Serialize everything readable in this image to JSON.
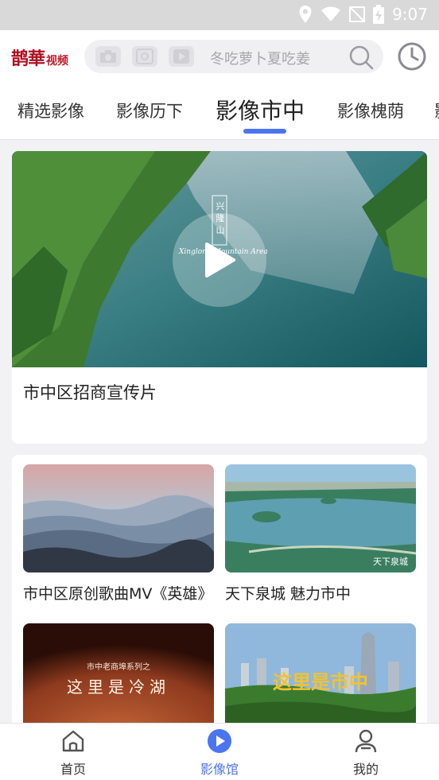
{
  "status_bar": {
    "time": "9:07"
  },
  "header": {
    "logo_main": "鹊華",
    "logo_sub": "视频",
    "search_placeholder": "冬吃萝卜夏吃姜"
  },
  "tabs": [
    {
      "label": "精选影像"
    },
    {
      "label": "影像历下"
    },
    {
      "label": "影像市中",
      "active": true
    },
    {
      "label": "影像槐荫"
    },
    {
      "label": "影"
    }
  ],
  "featured": {
    "title": "市中区招商宣传片",
    "overlay_text": "兴隆山",
    "overlay_sub": "Xinglong Mountain Area"
  },
  "videos": [
    {
      "title": "市中区原创歌曲MV《英雄》"
    },
    {
      "title": "天下泉城 魅力市中",
      "thumb_text": "天下泉城"
    },
    {
      "title": "",
      "thumb_text": "这里是冷湖",
      "thumb_sub": "市中老商埠系列之"
    },
    {
      "title": "",
      "thumb_text": "这里是市中"
    }
  ],
  "bottom_nav": [
    {
      "label": "首页",
      "icon": "home-icon"
    },
    {
      "label": "影像馆",
      "icon": "video-play-icon",
      "active": true
    },
    {
      "label": "我的",
      "icon": "user-icon"
    }
  ],
  "colors": {
    "accent": "#4b74f0",
    "logo": "#b01020"
  }
}
